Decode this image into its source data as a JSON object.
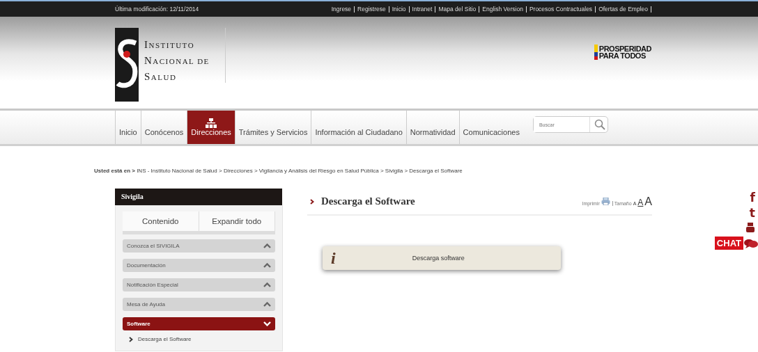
{
  "top_bar": {
    "last_modified": "Última modificación: 12/11/2014",
    "links": [
      "Ingrese",
      "Registrese",
      "Inicio",
      "Intranet",
      "Mapa del Sitio",
      "English Version",
      "Procesos Contractuales",
      "Ofertas de Empleo"
    ]
  },
  "header": {
    "logo_lines": [
      "INSTITUTO",
      "NACIONAL DE",
      "SALUD"
    ],
    "slogan_lines": [
      "PROSPERIDAD",
      "PARA TODOS"
    ]
  },
  "nav": {
    "items": [
      {
        "label": "Inicio",
        "selected": false
      },
      {
        "label": "Conócenos",
        "selected": false
      },
      {
        "label": "Direcciones",
        "selected": true
      },
      {
        "label": "Trámites y Servicios",
        "selected": false
      },
      {
        "label": "Información al Ciudadano",
        "selected": false
      },
      {
        "label": "Normatividad",
        "selected": false
      },
      {
        "label": "Comunicaciones",
        "selected": false
      }
    ],
    "search": {
      "placeholder": "Buscar"
    }
  },
  "breadcrumb": {
    "prefix": "Usted está en >",
    "path": "INS - Instituto Nacional de Salud > Direcciones > Vigilancia y Análisis del Riesgo en Salud Pública > Sivigila > Descarga el Software"
  },
  "sidebar": {
    "title": "Sivigila",
    "tabs": [
      "Contenido",
      "Expandir todo"
    ],
    "items": [
      {
        "label": "Conozca el SIVIGILA",
        "selected": false,
        "expanded": false
      },
      {
        "label": "Documentación",
        "selected": false,
        "expanded": false
      },
      {
        "label": "Notificación Especial",
        "selected": false,
        "expanded": false
      },
      {
        "label": "Mesa de Ayuda",
        "selected": false,
        "expanded": false
      },
      {
        "label": "Software",
        "selected": true,
        "expanded": true,
        "children": [
          "Descarga el Software"
        ]
      }
    ]
  },
  "main": {
    "title": "Descarga el Software",
    "print_label": "Imprimir",
    "size_label": "Tamaño",
    "size_options": [
      "A",
      "A",
      "A"
    ],
    "notice": {
      "icon": "i",
      "text": "Descarga software"
    }
  },
  "social": {
    "facebook": "f",
    "twitter": "t",
    "chat": "CHAT"
  }
}
